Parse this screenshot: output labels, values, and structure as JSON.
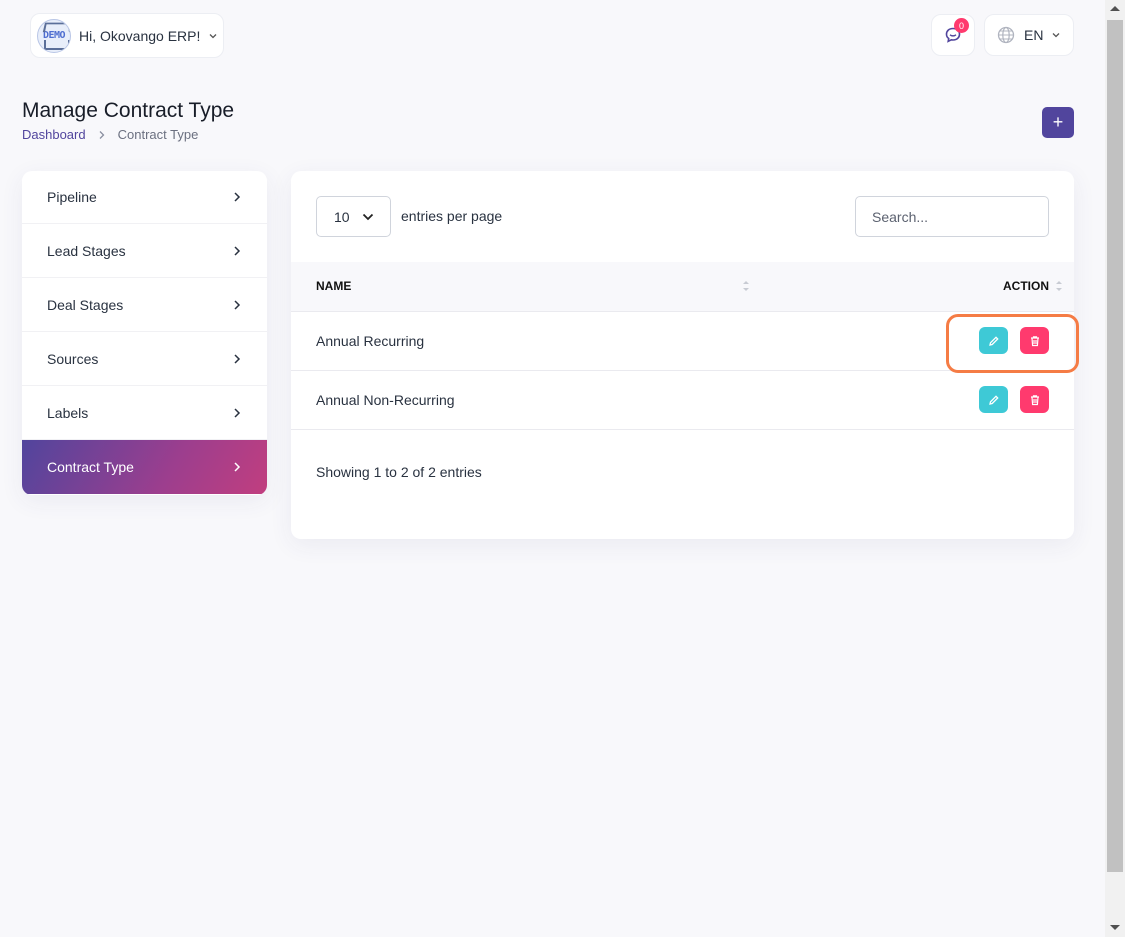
{
  "header": {
    "avatar_text": "DEMO",
    "greeting": "Hi, Okovango ERP!",
    "notification_count": "0",
    "language": "EN"
  },
  "page": {
    "title": "Manage Contract Type",
    "breadcrumb": [
      "Dashboard",
      "Contract Type"
    ],
    "add_button": "+"
  },
  "sidebar": {
    "items": [
      {
        "label": "Pipeline"
      },
      {
        "label": "Lead Stages"
      },
      {
        "label": "Deal Stages"
      },
      {
        "label": "Sources"
      },
      {
        "label": "Labels"
      },
      {
        "label": "Contract Type",
        "active": true
      }
    ]
  },
  "table": {
    "per_page": "10",
    "per_page_label": "entries per page",
    "search_placeholder": "Search...",
    "columns": [
      "NAME",
      "ACTION"
    ],
    "rows": [
      {
        "name": "Annual Recurring"
      },
      {
        "name": "Annual Non-Recurring"
      }
    ],
    "footer": "Showing 1 to 2 of 2 entries"
  },
  "colors": {
    "primary": "#51459d",
    "edit": "#3ec9d6",
    "delete": "#ff3a6e",
    "highlight": "#f57c45"
  }
}
